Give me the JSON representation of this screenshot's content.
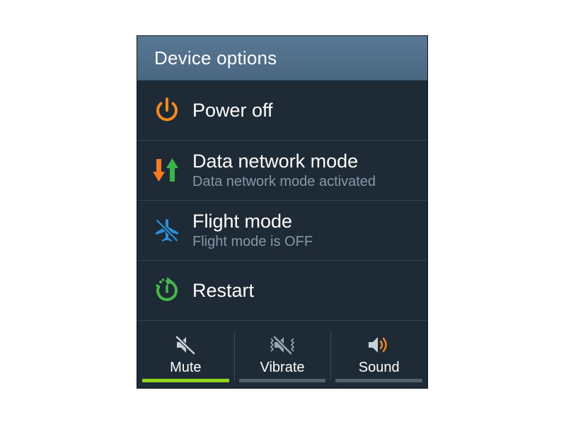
{
  "dialog": {
    "title": "Device options"
  },
  "items": [
    {
      "label": "Power off",
      "sublabel": "",
      "icon": "power-icon",
      "color": "#f28a1e"
    },
    {
      "label": "Data network mode",
      "sublabel": "Data network mode activated",
      "icon": "data-arrows-icon",
      "colors": [
        "#f47b20",
        "#3cb34a"
      ]
    },
    {
      "label": "Flight mode",
      "sublabel": "Flight mode is OFF",
      "icon": "airplane-off-icon",
      "color": "#2e8fd8"
    },
    {
      "label": "Restart",
      "sublabel": "",
      "icon": "restart-icon",
      "color": "#45b84a"
    }
  ],
  "sound_modes": [
    {
      "label": "Mute",
      "icon": "speaker-mute-icon",
      "active": true
    },
    {
      "label": "Vibrate",
      "icon": "vibrate-icon",
      "active": false
    },
    {
      "label": "Sound",
      "icon": "speaker-sound-icon",
      "active": false
    }
  ],
  "colors": {
    "title_bar": "#4f6d88",
    "background": "#1e2a36",
    "active_indicator": "#8fd61c",
    "inactive_indicator": "#52606d"
  }
}
